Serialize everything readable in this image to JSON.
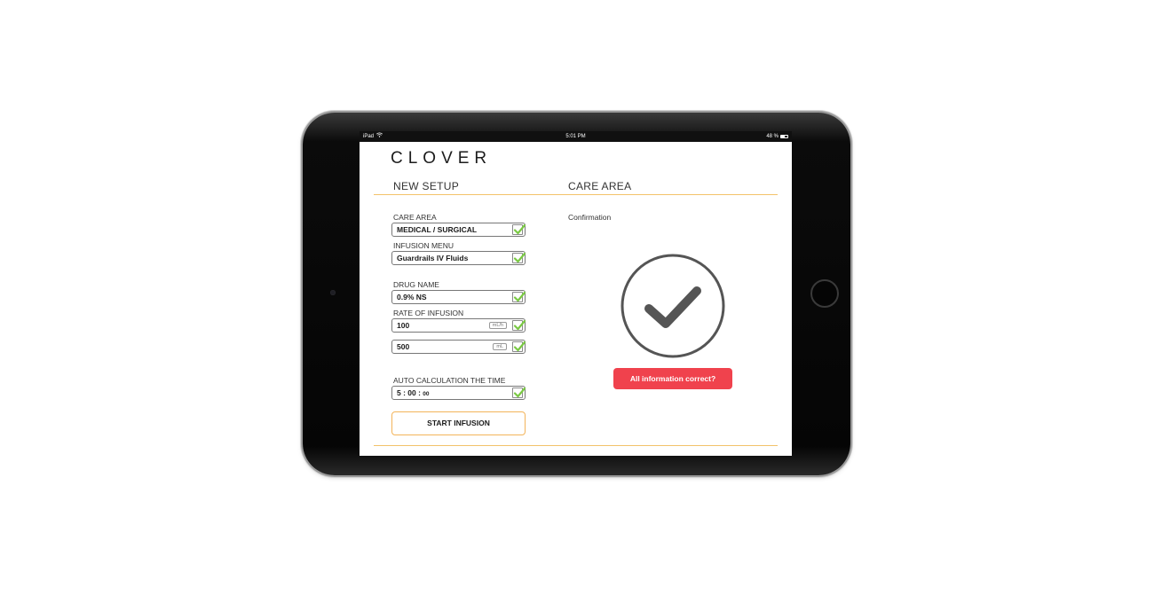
{
  "status_bar": {
    "device": "iPad",
    "time": "5:01 PM",
    "battery": "48 %"
  },
  "app": {
    "logo": "CLOVER"
  },
  "headers": {
    "left": "NEW SETUP",
    "right": "CARE AREA"
  },
  "form": {
    "care_area_label": "CARE AREA",
    "care_area_value": "MEDICAL / SURGICAL",
    "infusion_menu_label": "INFUSION MENU",
    "infusion_menu_value": "Guardrails IV Fluids",
    "drug_name_label": "DRUG NAME",
    "drug_name_value": "0.9% NS",
    "rate_label": "RATE OF INFUSION",
    "rate_value": "100",
    "rate_unit": "mL/h",
    "volume_value": "500",
    "volume_unit": "mL",
    "auto_calc_label": "AUTO CALCULATION THE TIME",
    "time_main": "5 : 00 : ",
    "time_seconds": "00",
    "start_button": "START INFUSION"
  },
  "confirmation": {
    "label": "Confirmation",
    "button": "All information correct?"
  },
  "colors": {
    "accent_orange": "#f3c36b",
    "check_green": "#7ac943",
    "confirm_red": "#f0424d",
    "big_check_gray": "#555555"
  }
}
